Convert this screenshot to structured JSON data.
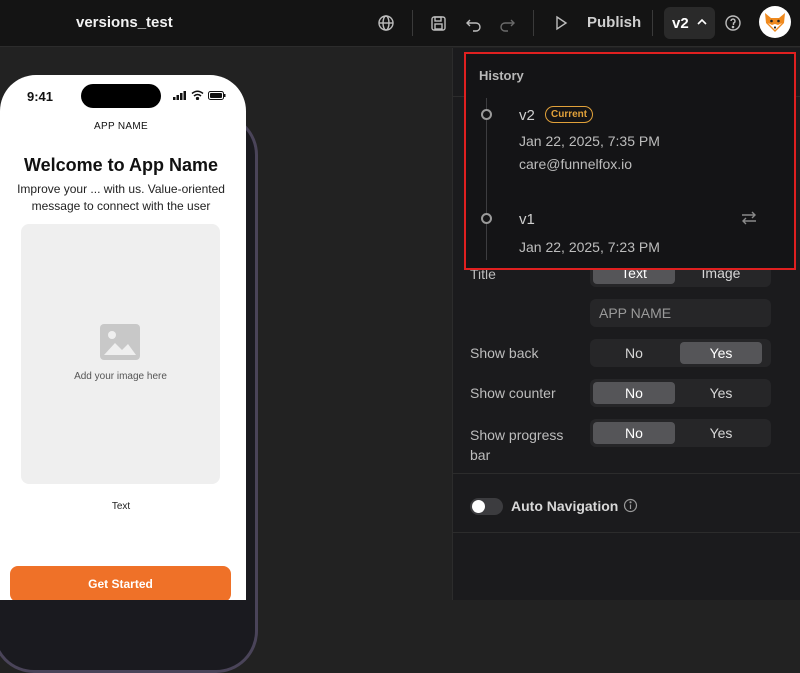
{
  "app": {
    "project_title": "versions_test"
  },
  "toolbar": {
    "publish_label": "Publish",
    "version_label": "v2",
    "icons": [
      "globe-icon",
      "save-icon",
      "undo-icon",
      "redo-icon",
      "play-icon",
      "chevron-up-icon",
      "help-icon"
    ],
    "avatar": "fox-avatar"
  },
  "phone": {
    "time": "9:41",
    "app_name": "APP NAME",
    "welcome_title": "Welcome to App Name",
    "subtitle": "Improve your ... with us. Value-oriented message to connect with the user",
    "image_placeholder": "Add your image here",
    "text_label": "Text",
    "cta_label": "Get Started"
  },
  "settings": {
    "title_label": "Title",
    "title_options": [
      "Text",
      "Image"
    ],
    "title_selected": "Text",
    "app_name_value": "APP NAME",
    "show_back_label": "Show back",
    "show_back_options": [
      "No",
      "Yes"
    ],
    "show_back_selected": "Yes",
    "show_counter_label": "Show counter",
    "show_counter_options": [
      "No",
      "Yes"
    ],
    "show_counter_selected": "No",
    "show_progress_label": "Show progress bar",
    "show_progress_options": [
      "No",
      "Yes"
    ],
    "show_progress_selected": "No",
    "auto_navigation_label": "Auto Navigation",
    "auto_navigation_on": false
  },
  "history": {
    "title": "History",
    "entries": [
      {
        "version": "v2",
        "badge": "Current",
        "date": "Jan 22, 2025, 7:35 PM",
        "author": "care@funnelfox.io"
      },
      {
        "version": "v1",
        "date": "Jan 22, 2025, 7:23 PM"
      }
    ]
  },
  "colors": {
    "accent_orange": "#ef7128",
    "badge_gold": "#e1a13a",
    "highlight_red": "#e02020"
  }
}
